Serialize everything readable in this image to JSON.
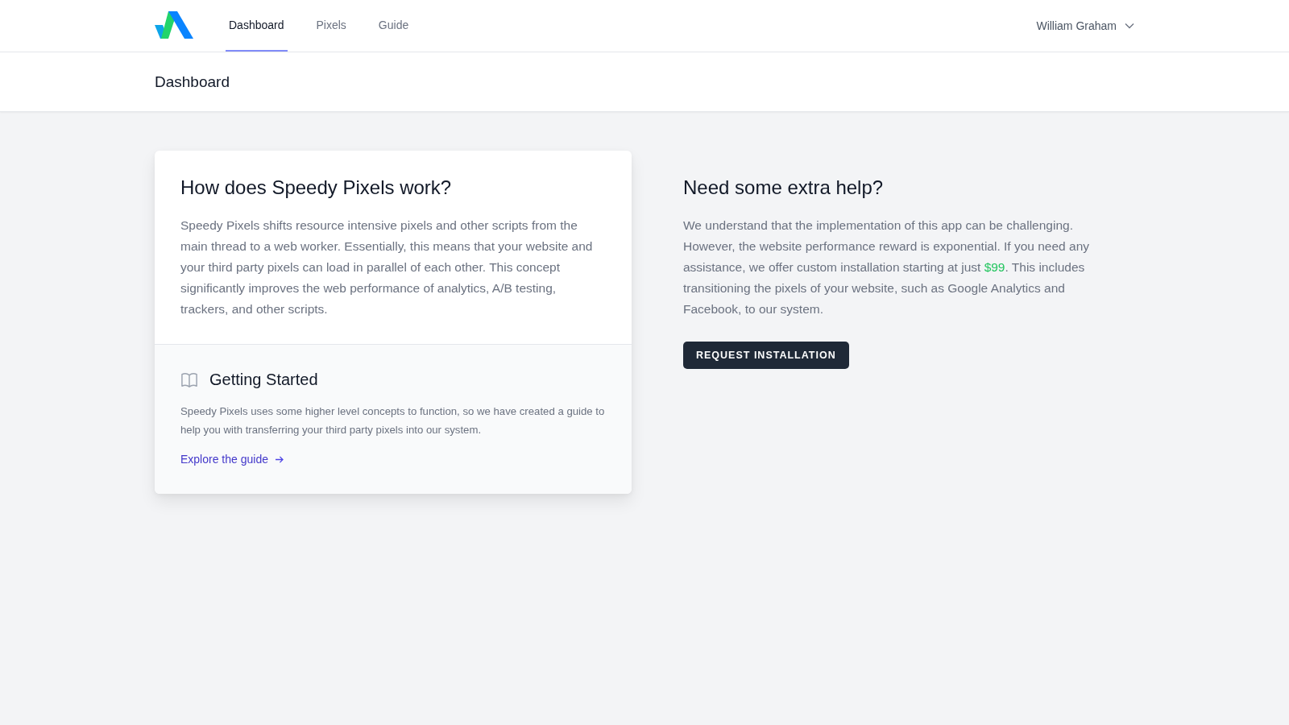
{
  "nav": {
    "tabs": [
      {
        "label": "Dashboard",
        "selected": true
      },
      {
        "label": "Pixels",
        "selected": false
      },
      {
        "label": "Guide",
        "selected": false
      }
    ],
    "user": "William Graham"
  },
  "page_title": "Dashboard",
  "card": {
    "title": "How does Speedy Pixels work?",
    "body": "Speedy Pixels shifts resource intensive pixels and other scripts from the main thread to a web worker. Essentially, this means that your website and your third party pixels can load in parallel of each other. This concept significantly improves the web performance of analytics, A/B testing, trackers, and other scripts.",
    "section": {
      "title": "Getting Started",
      "body": "Speedy Pixels uses some higher level concepts to function, so we have created a guide to help you with transferring your third party pixels into our system.",
      "link": "Explore the guide"
    }
  },
  "help": {
    "title": "Need some extra help?",
    "body": [
      {
        "kind": "plain",
        "text": "We understand that the implementation of this app can be challenging. However, the website performance reward is exponential. If you need any assistance, we offer custom installation starting at just "
      },
      {
        "kind": "price",
        "text": "$99"
      },
      {
        "kind": "plain",
        "text": ". This includes transitioning the pixels of your website, such as Google Analytics and Facebook, to our system."
      }
    ],
    "button": "REQUEST INSTALLATION"
  }
}
